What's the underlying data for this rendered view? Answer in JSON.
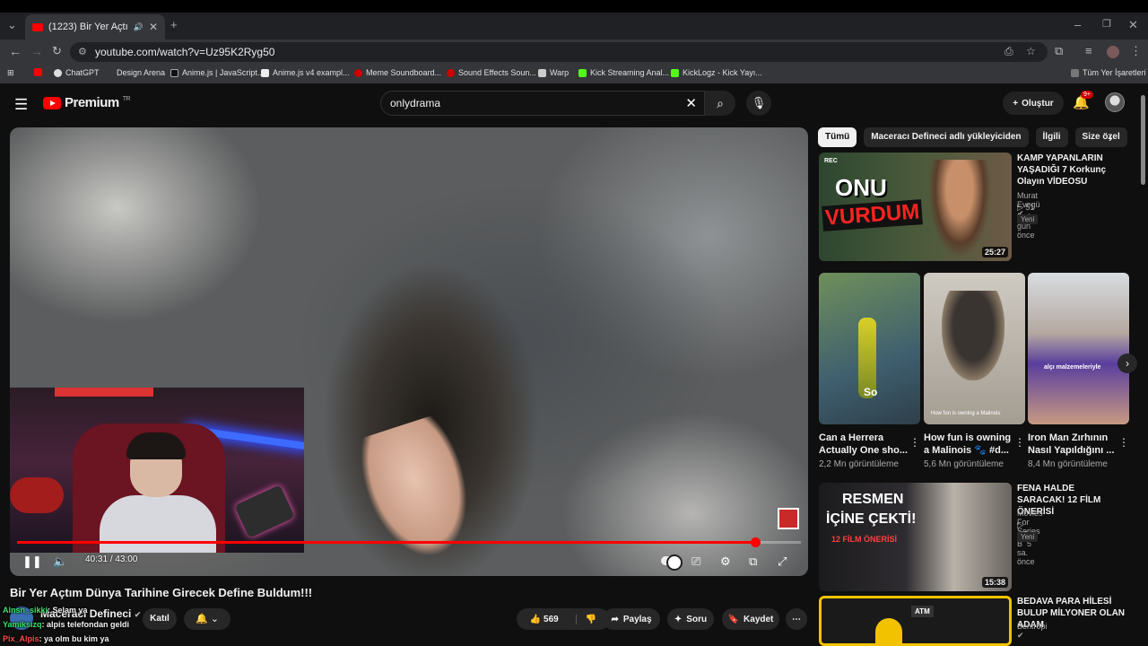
{
  "browser": {
    "tab_title": "(1223) Bir Yer Açtım Dünya",
    "url": "youtube.com/watch?v=Uz95K2Ryg50",
    "bookmarks": [
      "ChatGPT",
      "Design Arena",
      "Anime.js | JavaScript...",
      "Anime.js v4 exampl...",
      "Meme Soundboard...",
      "Sound Effects Soun...",
      "Warp",
      "Kick Streaming Anal...",
      "KickLogz - Kick Yayı..."
    ],
    "all_bookmarks": "Tüm Yer İşaretleri"
  },
  "header": {
    "logo": "Premium",
    "region": "TR",
    "search_value": "onlydrama",
    "create_label": "Oluştur",
    "notif_count": "9+"
  },
  "player": {
    "current_time": "40:31",
    "separator": "/",
    "duration": "43:00",
    "progress": 0.942
  },
  "video": {
    "title": "Bir Yer Açtım Dünya Tarihine Girecek Define Buldum!!!",
    "channel": "Maceracı Defineci",
    "join": "Katıl",
    "likes": "569",
    "share": "Paylaş",
    "ask": "Soru",
    "save": "Kaydet"
  },
  "chat": [
    {
      "user": "Alnsn_sikki",
      "text": ": Selam ya",
      "color": "#3ee06a"
    },
    {
      "user": "Yamiksizq",
      "text": ": alpis telefondan geldi",
      "color": "#3ee06a"
    },
    {
      "user": "Pix_Alpis",
      "text": ": ya olm bu kim ya",
      "color": "#ff4b4b"
    }
  ],
  "chips": [
    "Tümü",
    "Maceracı Defineci adlı yükleyiciden",
    "İlgili",
    "Size özel"
  ],
  "recs": [
    {
      "title": "KAMP YAPANLARIN YAŞADIĞI 7 Korkunç Olayın VİDEOSU",
      "channel": "Murat Evegü",
      "views": "51 B",
      "age": "3 gün önce",
      "new": "Yeni",
      "duration": "25:27",
      "thumb_text_1": "ONU",
      "thumb_text_2": "VURDUM",
      "thumb_badge": "REC"
    },
    {
      "title": "FENA HALDE SARACAK! 12 FİLM ÖNERİSİ",
      "channel": "Movies For Series",
      "views": "6,5 B",
      "age": "5 sa. önce",
      "new": "Yeni",
      "duration": "15:38",
      "thumb_text_1": "RESMEN",
      "thumb_text_2": "İÇİNE ÇEKTİ!",
      "thumb_text_3": "12 FİLM ÖNERİSİ"
    },
    {
      "title": "BEDAVA PARA HİLESİ BULUP MİLYONER OLAN ADAM",
      "channel": "Bentropi",
      "thumb_text_1": "ATM"
    }
  ],
  "shorts": [
    {
      "title": "Can a Herrera Actually One sho...",
      "views": "2,2 Mn görüntüleme",
      "caption": "So"
    },
    {
      "title": "How fun is owning a Malinois 🐾 #d...",
      "views": "5,6 Mn görüntüleme",
      "caption": "How fun is owning a Malinois"
    },
    {
      "title": "Iron Man Zırhının Nasıl Yapıldığını ...",
      "views": "8,4 Mn görüntüleme",
      "caption": "alçı malzemeleriyle"
    }
  ],
  "colors": {
    "accent": "#ff0000",
    "bg": "#0f0f0f",
    "chip": "#272727"
  }
}
